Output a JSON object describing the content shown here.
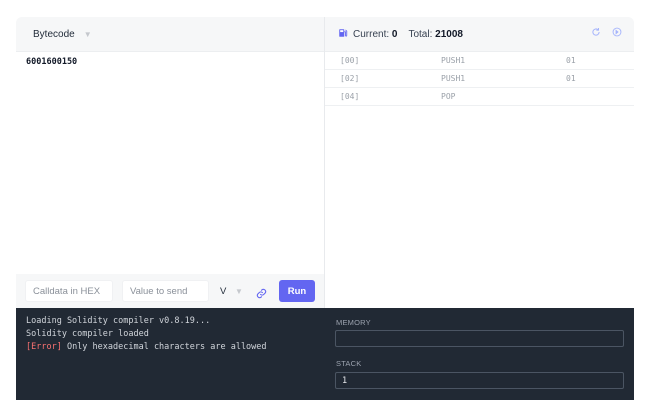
{
  "editor": {
    "language": "Bytecode",
    "code": "6001600150"
  },
  "toolbar": {
    "calldata_placeholder": "Calldata in HEX",
    "value_placeholder": "Value to send",
    "unit": "V",
    "run_label": "Run"
  },
  "execution": {
    "current_label": "Current:",
    "current_value": "0",
    "total_label": "Total:",
    "total_value": "21008",
    "opcodes": [
      {
        "pc": "[00]",
        "name": "PUSH1",
        "value": "01"
      },
      {
        "pc": "[02]",
        "name": "PUSH1",
        "value": "01"
      },
      {
        "pc": "[04]",
        "name": "POP",
        "value": ""
      }
    ]
  },
  "console": {
    "lines": [
      {
        "prefix": "",
        "text": "Loading Solidity compiler v0.8.19..."
      },
      {
        "prefix": "",
        "text": "Solidity compiler loaded"
      },
      {
        "prefix": "[Error]",
        "text": " Only hexadecimal characters are allowed"
      }
    ],
    "memory_label": "MEMORY",
    "memory_value": "",
    "stack_label": "STACK",
    "stack_value": "1"
  },
  "colors": {
    "accent": "#6366f1",
    "console_bg": "#212934",
    "error": "#f87171"
  }
}
